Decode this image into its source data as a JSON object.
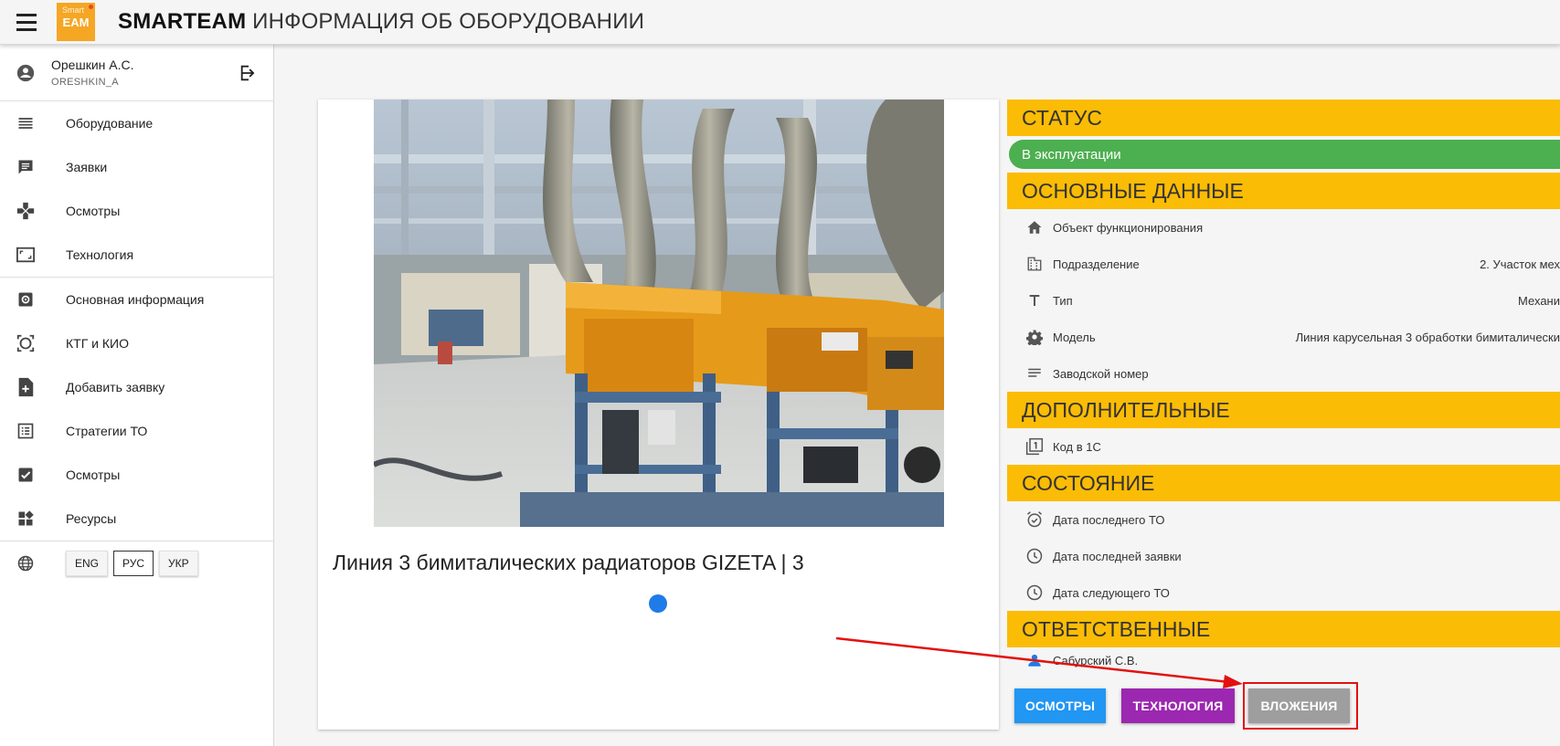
{
  "header": {
    "brand": "SMARTEAM",
    "title": "ИНФОРМАЦИЯ ОБ ОБОРУДОВАНИИ",
    "logo_text": "EAM",
    "logo_small": "Smart"
  },
  "user": {
    "name": "Орешкин А.С.",
    "login": "ORESHKIN_A"
  },
  "sidebar": {
    "items": [
      {
        "label": "Оборудование",
        "icon": "list-icon"
      },
      {
        "label": "Заявки",
        "icon": "chat-icon"
      },
      {
        "label": "Осмотры",
        "icon": "gamepad-icon"
      },
      {
        "label": "Технология",
        "icon": "aspect-ratio-icon"
      },
      {
        "label": "Основная информация",
        "icon": "settings-icon"
      },
      {
        "label": "КТГ и КИО",
        "icon": "filter-center-icon"
      },
      {
        "label": "Добавить заявку",
        "icon": "note-add-icon"
      },
      {
        "label": "Стратегии ТО",
        "icon": "list-alt-icon"
      },
      {
        "label": "Осмотры",
        "icon": "check-box-icon"
      },
      {
        "label": "Ресурсы",
        "icon": "widgets-icon"
      }
    ],
    "languages": [
      "ENG",
      "РУС",
      "УКР"
    ],
    "active_language": "РУС"
  },
  "equipment": {
    "title": "Линия 3 бимиталических радиаторов GIZETA | 3"
  },
  "panel": {
    "status_header": "СТАТУС",
    "status_value": "В эксплуатации",
    "main_header": "ОСНОВНЫЕ ДАННЫЕ",
    "main_rows": [
      {
        "label": "Объект функционирования",
        "value": "",
        "icon": "home-icon"
      },
      {
        "label": "Подразделение",
        "value": "2. Участок мех",
        "icon": "domain-icon"
      },
      {
        "label": "Тип",
        "value": "Механи",
        "icon": "text-icon"
      },
      {
        "label": "Модель",
        "value": "Линия карусельная 3 обработки бимиталически",
        "icon": "gear-icon"
      },
      {
        "label": "Заводской номер",
        "value": "",
        "icon": "subject-icon"
      }
    ],
    "extra_header": "ДОПОЛНИТЕЛЬНЫЕ",
    "extra_rows": [
      {
        "label": "Код в 1С",
        "value": "",
        "icon": "filter-1-icon"
      }
    ],
    "state_header": "СОСТОЯНИЕ",
    "state_rows": [
      {
        "label": "Дата последнего ТО",
        "value": "",
        "icon": "alarm-on-icon"
      },
      {
        "label": "Дата последней заявки",
        "value": "",
        "icon": "clock-icon"
      },
      {
        "label": "Дата следующего ТО",
        "value": "",
        "icon": "clock-icon"
      }
    ],
    "resp_header": "ОТВЕТСТВЕННЫЕ",
    "resp_rows": [
      {
        "label": "Сабурский С.В.",
        "icon": "person-icon"
      }
    ]
  },
  "actions": {
    "inspections": "ОСМОТРЫ",
    "technology": "ТЕХНОЛОГИЯ",
    "attachments": "ВЛОЖЕНИЯ"
  },
  "colors": {
    "accent": "#fbbc05",
    "status_green": "#4caf50",
    "btn_blue": "#2196f3",
    "btn_purple": "#9c27b0",
    "btn_grey": "#9e9e9e",
    "highlight_red": "#e31010"
  }
}
